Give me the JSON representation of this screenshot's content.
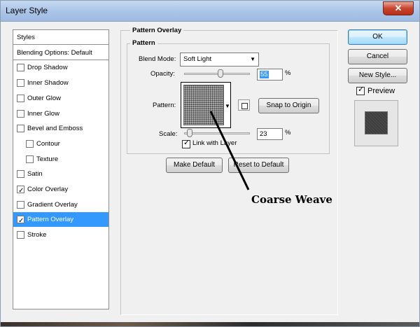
{
  "window": {
    "title": "Layer Style",
    "close_glyph": "✕"
  },
  "sidebar": {
    "items": [
      {
        "label": "Styles",
        "checkbox": false,
        "checked": false,
        "indent": 0,
        "selected": false,
        "separator": true
      },
      {
        "label": "Blending Options: Default",
        "checkbox": false,
        "checked": false,
        "indent": 0,
        "selected": false,
        "separator": true
      },
      {
        "label": "Drop Shadow",
        "checkbox": true,
        "checked": false,
        "indent": 0,
        "selected": false
      },
      {
        "label": "Inner Shadow",
        "checkbox": true,
        "checked": false,
        "indent": 0,
        "selected": false
      },
      {
        "label": "Outer Glow",
        "checkbox": true,
        "checked": false,
        "indent": 0,
        "selected": false
      },
      {
        "label": "Inner Glow",
        "checkbox": true,
        "checked": false,
        "indent": 0,
        "selected": false
      },
      {
        "label": "Bevel and Emboss",
        "checkbox": true,
        "checked": false,
        "indent": 0,
        "selected": false
      },
      {
        "label": "Contour",
        "checkbox": true,
        "checked": false,
        "indent": 1,
        "selected": false
      },
      {
        "label": "Texture",
        "checkbox": true,
        "checked": false,
        "indent": 1,
        "selected": false
      },
      {
        "label": "Satin",
        "checkbox": true,
        "checked": false,
        "indent": 0,
        "selected": false
      },
      {
        "label": "Color Overlay",
        "checkbox": true,
        "checked": true,
        "indent": 0,
        "selected": false
      },
      {
        "label": "Gradient Overlay",
        "checkbox": true,
        "checked": false,
        "indent": 0,
        "selected": false
      },
      {
        "label": "Pattern Overlay",
        "checkbox": true,
        "checked": true,
        "indent": 0,
        "selected": true
      },
      {
        "label": "Stroke",
        "checkbox": true,
        "checked": false,
        "indent": 0,
        "selected": false
      }
    ]
  },
  "pattern_overlay": {
    "section_title": "Pattern Overlay",
    "group_title": "Pattern",
    "blend_mode_label": "Blend Mode:",
    "blend_mode_value": "Soft Light",
    "opacity_label": "Opacity:",
    "opacity_value": "55",
    "opacity_fraction": 0.55,
    "percent_sign": "%",
    "pattern_label": "Pattern:",
    "snap_button": "Snap to Origin",
    "scale_label": "Scale:",
    "scale_value": "23",
    "scale_fraction": 0.08,
    "link_label": "Link with Layer",
    "link_checked": true,
    "make_default_button": "Make Default",
    "reset_default_button": "Reset to Default"
  },
  "actions": {
    "ok": "OK",
    "cancel": "Cancel",
    "new_style": "New Style...",
    "preview_label": "Preview",
    "preview_checked": true
  },
  "annotation": {
    "text": "Coarse Weave"
  },
  "colors": {
    "selection": "#3399ff",
    "dialog_bg": "#f0f0f0"
  }
}
